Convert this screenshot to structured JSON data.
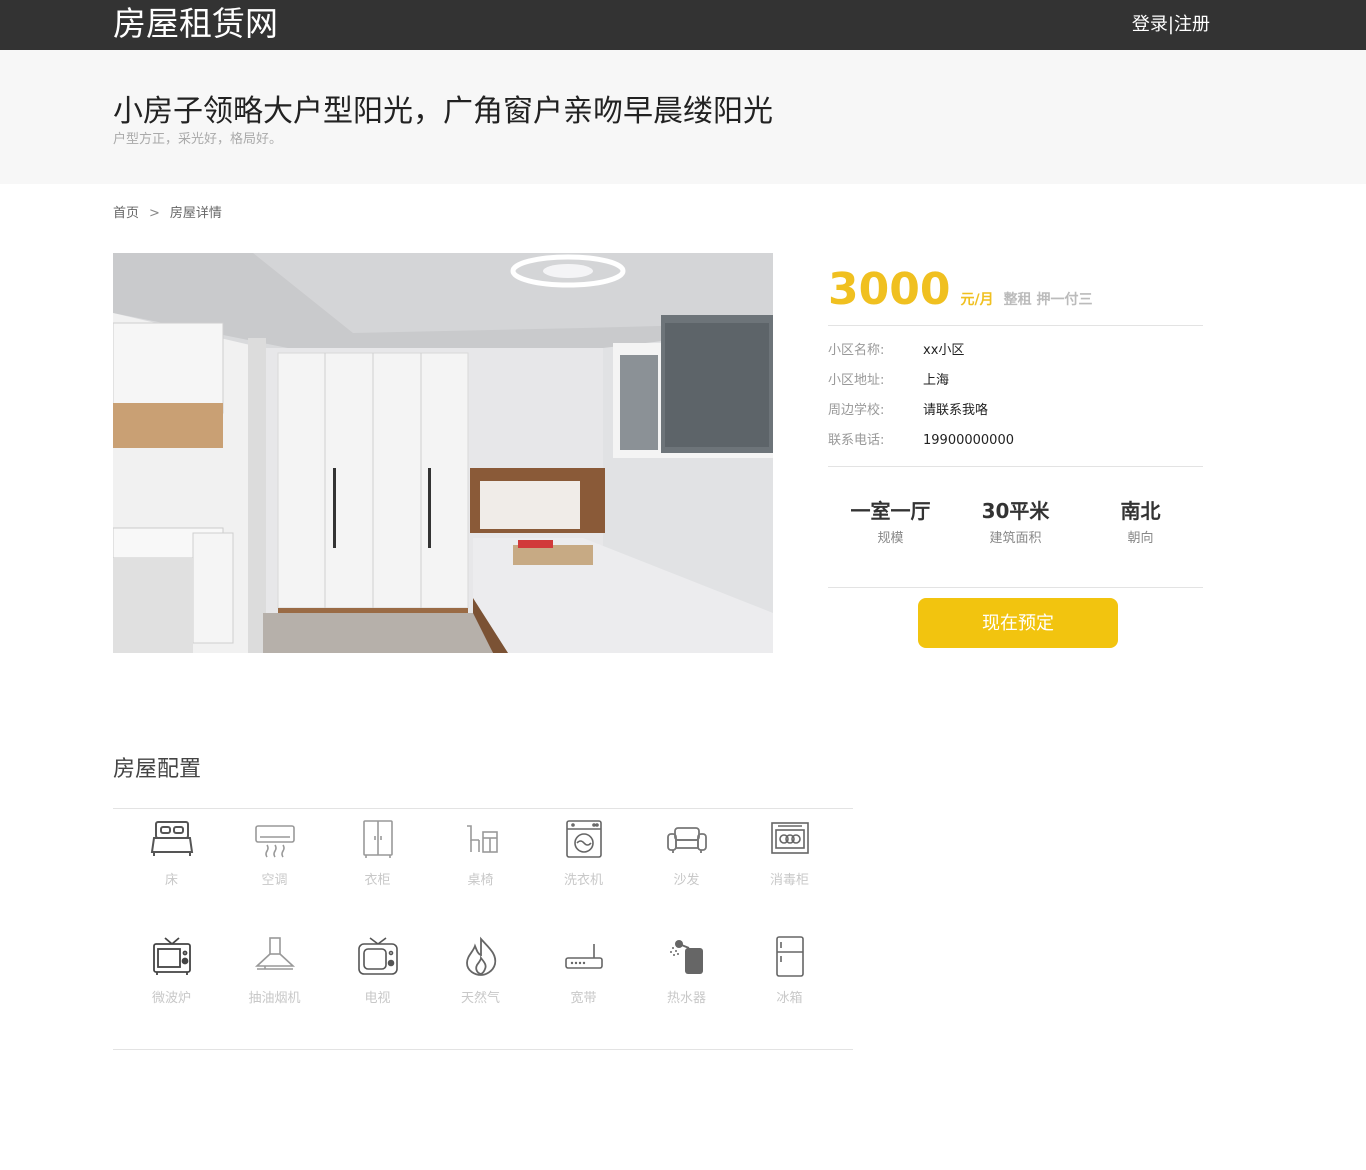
{
  "header": {
    "logo": "房屋租赁网",
    "login": "登录",
    "divider": "|",
    "register": "注册"
  },
  "banner": {
    "title": "小房子领略大户型阳光，广角窗户亲吻早晨缕阳光",
    "subtitle": "户型方正，采光好，格局好。"
  },
  "breadcrumb": {
    "home": "首页",
    "sep": ">",
    "current": "房屋详情"
  },
  "price": {
    "amount": "3000",
    "unit": "元/月",
    "rent_type": "整租 押一付三"
  },
  "details": [
    {
      "key": "小区名称:",
      "value": "xx小区"
    },
    {
      "key": "小区地址:",
      "value": "上海"
    },
    {
      "key": "周边学校:",
      "value": "请联系我咯"
    },
    {
      "key": "联系电话:",
      "value": "19900000000"
    }
  ],
  "stats": [
    {
      "value": "一室一厅",
      "label": "规模"
    },
    {
      "value": "30平米",
      "label": "建筑面积"
    },
    {
      "value": "南北",
      "label": "朝向"
    }
  ],
  "book_button": "现在预定",
  "facilities": {
    "title": "房屋配置",
    "items": [
      {
        "label": "床",
        "icon": "bed-icon"
      },
      {
        "label": "空调",
        "icon": "air-conditioner-icon"
      },
      {
        "label": "衣柜",
        "icon": "wardrobe-icon"
      },
      {
        "label": "桌椅",
        "icon": "desk-chair-icon"
      },
      {
        "label": "洗衣机",
        "icon": "washing-machine-icon"
      },
      {
        "label": "沙发",
        "icon": "sofa-icon"
      },
      {
        "label": "消毒柜",
        "icon": "disinfection-cabinet-icon"
      },
      {
        "label": "微波炉",
        "icon": "microwave-icon"
      },
      {
        "label": "抽油烟机",
        "icon": "range-hood-icon"
      },
      {
        "label": "电视",
        "icon": "tv-icon"
      },
      {
        "label": "天然气",
        "icon": "gas-flame-icon"
      },
      {
        "label": "宽带",
        "icon": "router-icon"
      },
      {
        "label": "热水器",
        "icon": "water-heater-icon"
      },
      {
        "label": "冰箱",
        "icon": "fridge-icon"
      }
    ]
  },
  "colors": {
    "topbar": "#333333",
    "accent": "#f2c40f",
    "banner_bg": "#f7f7f7"
  }
}
